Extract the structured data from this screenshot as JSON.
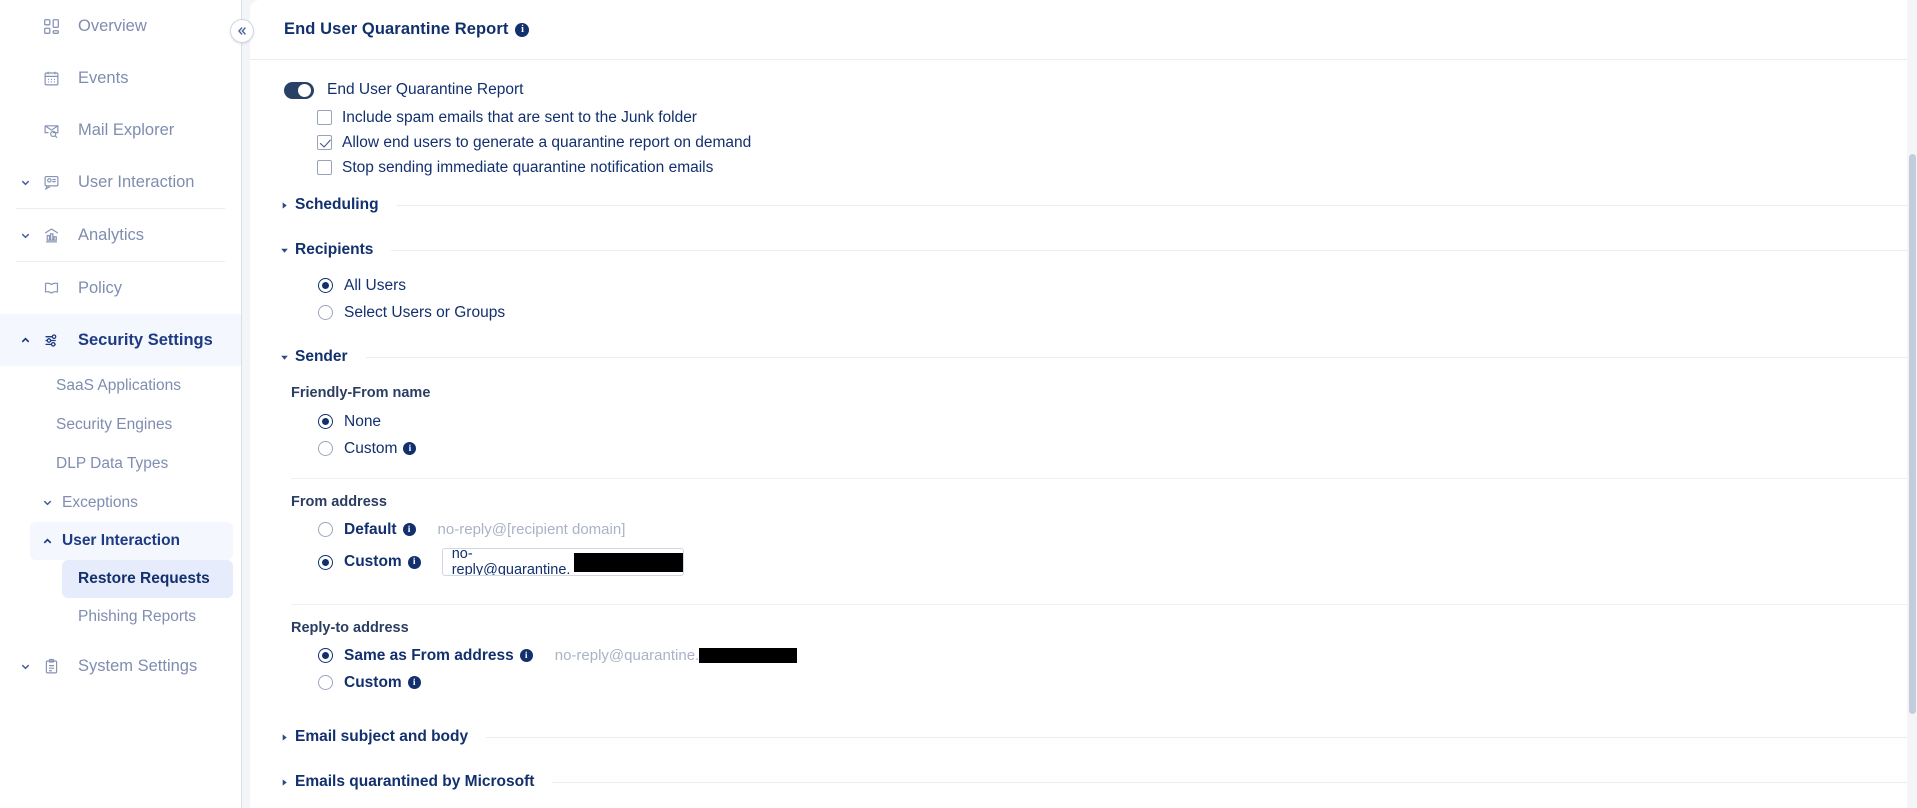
{
  "sidebar": {
    "items": [
      {
        "label": "Overview",
        "icon": "dashboard-icon",
        "caret": "none",
        "active": false
      },
      {
        "label": "Events",
        "icon": "calendar-icon",
        "caret": "none",
        "active": false
      },
      {
        "label": "Mail Explorer",
        "icon": "mail-search-icon",
        "caret": "none",
        "active": false
      },
      {
        "label": "User Interaction",
        "icon": "user-interaction-icon",
        "caret": "down",
        "active": false
      },
      {
        "label": "Analytics",
        "icon": "analytics-icon",
        "caret": "down",
        "active": false
      },
      {
        "label": "Policy",
        "icon": "policy-book-icon",
        "caret": "none",
        "active": false
      },
      {
        "label": "Security Settings",
        "icon": "sliders-icon",
        "caret": "up",
        "active": true
      }
    ],
    "sub_items": [
      {
        "label": "SaaS Applications",
        "caret": "none"
      },
      {
        "label": "Security Engines",
        "caret": "none"
      },
      {
        "label": "DLP Data Types",
        "caret": "none"
      },
      {
        "label": "Exceptions",
        "caret": "down"
      }
    ],
    "group": {
      "label": "User Interaction",
      "caret": "up"
    },
    "group_children": [
      {
        "label": "Restore Requests",
        "selected": true
      },
      {
        "label": "Phishing Reports",
        "selected": false
      }
    ],
    "footer_item": {
      "label": "System Settings",
      "icon": "clipboard-icon",
      "caret": "down"
    },
    "collapse_icon": "chevron-double-left-icon"
  },
  "panel": {
    "title": "End User Quarantine Report",
    "title_info_icon": "info-icon",
    "toggle": {
      "label": "End User Quarantine Report",
      "on": true
    },
    "checkboxes": [
      {
        "label": "Include spam emails that are sent to the Junk folder",
        "checked": false
      },
      {
        "label": "Allow end users to generate a quarantine report on demand",
        "checked": true
      },
      {
        "label": "Stop sending immediate quarantine notification emails",
        "checked": false
      }
    ],
    "sections": {
      "scheduling": {
        "title": "Scheduling",
        "expanded": false
      },
      "recipients": {
        "title": "Recipients",
        "expanded": true
      },
      "sender": {
        "title": "Sender",
        "expanded": true
      },
      "email_subject_and_body": {
        "title": "Email subject and body",
        "expanded": false
      },
      "emails_quarantined_by_microsoft": {
        "title": "Emails quarantined by Microsoft",
        "expanded": false
      }
    },
    "recipients_options": [
      {
        "label": "All Users",
        "selected": true
      },
      {
        "label": "Select Users or Groups",
        "selected": false
      }
    ],
    "friendly_from": {
      "heading": "Friendly-From name",
      "options": [
        {
          "label": "None",
          "selected": true,
          "info": false
        },
        {
          "label": "Custom",
          "selected": false,
          "info": true
        }
      ]
    },
    "from_address": {
      "heading": "From address",
      "options": [
        {
          "label": "Default",
          "selected": false,
          "info": true,
          "hint": "no-reply@[recipient domain]"
        },
        {
          "label": "Custom",
          "selected": true,
          "info": true,
          "value": "no-reply@quarantine."
        }
      ]
    },
    "reply_to_address": {
      "heading": "Reply-to address",
      "options": [
        {
          "label": "Same as From address",
          "selected": true,
          "info": true,
          "hint": "no-reply@quarantine."
        },
        {
          "label": "Custom",
          "selected": false,
          "info": true
        }
      ]
    }
  },
  "colors": {
    "accent": "#12306e",
    "muted": "#7f8db0",
    "rule": "#e9ecf2",
    "selected_bg": "#e6ecfb",
    "active_bg": "#f4f7fd",
    "redaction": "#000000"
  }
}
